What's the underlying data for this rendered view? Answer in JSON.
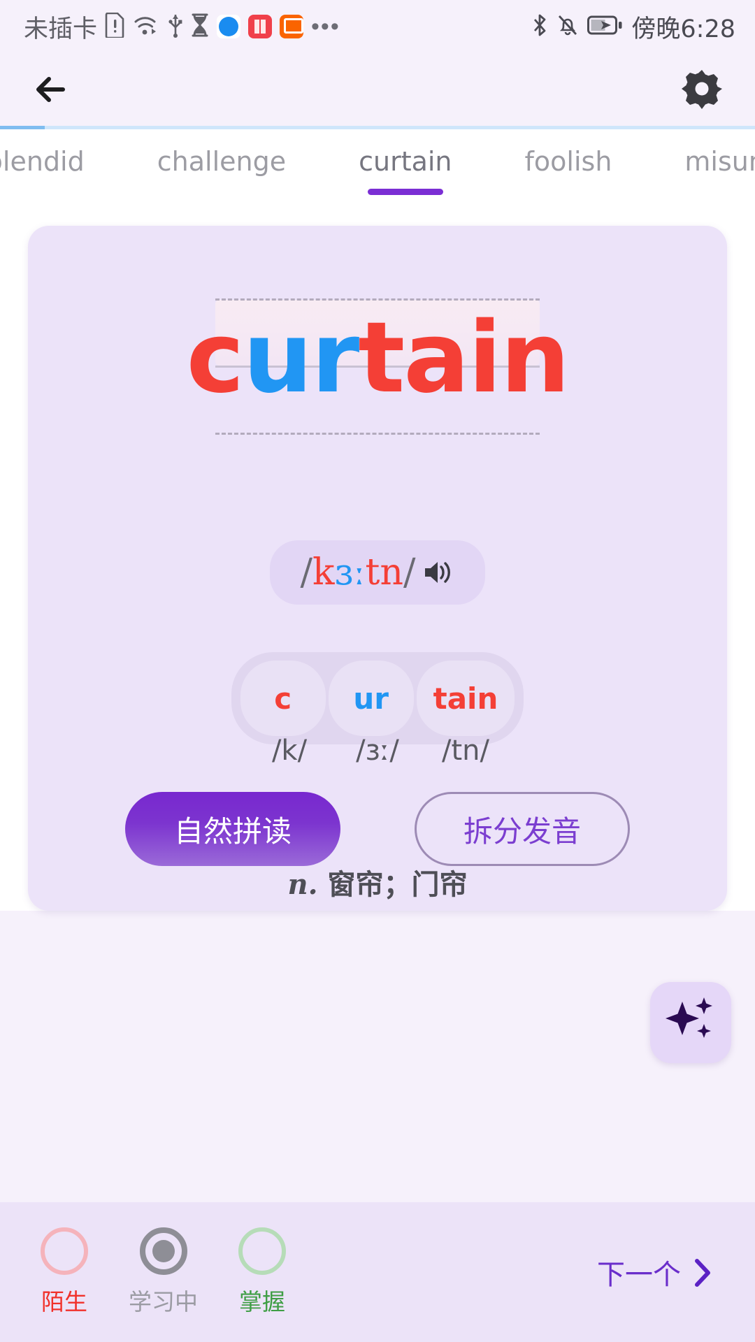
{
  "statusbar": {
    "carrier": "未插卡",
    "time": "傍晚6:28",
    "icons": [
      "sim-card-alert-icon",
      "wifi-icon",
      "usb-icon",
      "hourglass-icon",
      "safari-app-icon",
      "book-app-icon",
      "kuaishou-app-icon",
      "more-dots-icon",
      "bluetooth-icon",
      "notifications-off-icon",
      "battery-charging-icon"
    ]
  },
  "navbar": {
    "back_label": "back-arrow",
    "settings_label": "settings-gear"
  },
  "tabs": {
    "items": [
      {
        "label": "splendid",
        "active": false
      },
      {
        "label": "challenge",
        "active": false
      },
      {
        "label": "curtain",
        "active": true
      },
      {
        "label": "foolish",
        "active": false
      },
      {
        "label": "misunders",
        "active": false
      }
    ]
  },
  "card": {
    "word": {
      "text": "curtain",
      "segments": [
        {
          "text": "c",
          "color": "red"
        },
        {
          "text": "ur",
          "color": "blue"
        },
        {
          "text": "tain",
          "color": "red"
        }
      ]
    },
    "phonetic": {
      "open": "/",
      "close": "/",
      "segments": [
        {
          "text": "k",
          "color": "red"
        },
        {
          "text": "ɜː",
          "color": "blue"
        },
        {
          "text": "tn",
          "color": "red"
        }
      ],
      "speaker_icon": "speaker-icon"
    },
    "syllables": [
      {
        "letters": "c",
        "color": "red",
        "ipa": "/k/"
      },
      {
        "letters": "ur",
        "color": "blue",
        "ipa": "/ɜː/"
      },
      {
        "letters": "tain",
        "color": "red",
        "ipa": "/tn/"
      }
    ],
    "definition": {
      "pos": "n.",
      "meaning": "窗帘；门帘"
    },
    "buttons": {
      "primary": "自然拼读",
      "secondary": "拆分发音"
    }
  },
  "fab": {
    "icon": "sparkles-icon"
  },
  "bottombar": {
    "statuses": [
      {
        "label": "陌生",
        "state": "unknown"
      },
      {
        "label": "学习中",
        "state": "learning"
      },
      {
        "label": "掌握",
        "state": "mastered"
      }
    ],
    "next_label": "下一个"
  },
  "colors": {
    "red": "#f43f36",
    "blue": "#2196f3",
    "purple": "#7b2ed4",
    "card_bg": "#ece3f9",
    "page_bg": "#f6f1fb"
  }
}
